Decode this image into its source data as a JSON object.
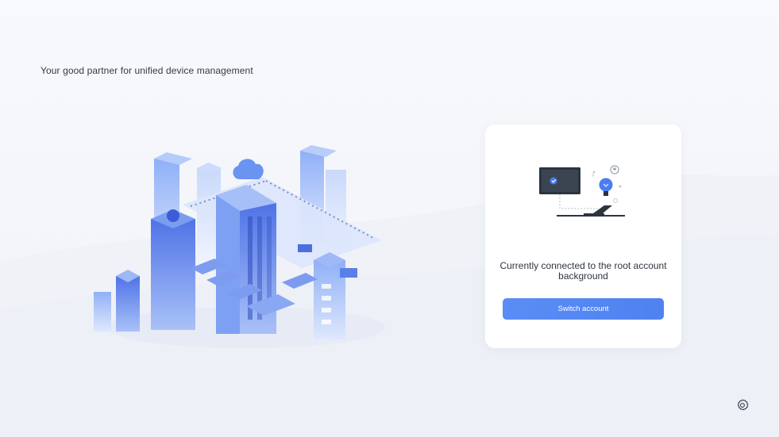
{
  "header": {
    "tagline": "Your good partner for unified device management"
  },
  "login_card": {
    "status_line1": "Currently connected to the root account",
    "status_line2": "background",
    "switch_button_label": "Switch account"
  },
  "icons": {
    "settings": "gear-icon"
  },
  "colors": {
    "accent": "#5b8df6",
    "background": "#f5f7fb",
    "card": "#ffffff"
  }
}
